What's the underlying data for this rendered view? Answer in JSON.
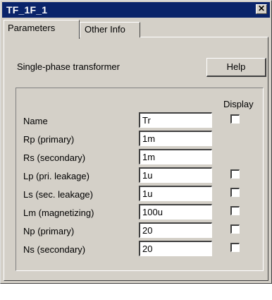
{
  "window": {
    "title": "TF_1F_1",
    "close_symbol": "✕"
  },
  "tabs": [
    {
      "label": "Parameters",
      "active": true
    },
    {
      "label": "Other Info",
      "active": false
    }
  ],
  "panel": {
    "description": "Single-phase transformer",
    "help_label": "Help",
    "display_header": "Display"
  },
  "params": [
    {
      "label": "Name",
      "value": "Tr",
      "has_display": true,
      "display_checked": false
    },
    {
      "label": "Rp (primary)",
      "value": "1m",
      "has_display": false
    },
    {
      "label": "Rs (secondary)",
      "value": "1m",
      "has_display": false
    },
    {
      "label": "Lp (pri. leakage)",
      "value": "1u",
      "has_display": true,
      "display_checked": false
    },
    {
      "label": "Ls (sec. leakage)",
      "value": "1u",
      "has_display": true,
      "display_checked": false
    },
    {
      "label": "Lm (magnetizing)",
      "value": "100u",
      "has_display": true,
      "display_checked": false
    },
    {
      "label": "Np (primary)",
      "value": "20",
      "has_display": true,
      "display_checked": false
    },
    {
      "label": "Ns (secondary)",
      "value": "20",
      "has_display": true,
      "display_checked": false
    }
  ],
  "colors": {
    "titlebar": "#0a246a",
    "face": "#d4d0c8"
  }
}
